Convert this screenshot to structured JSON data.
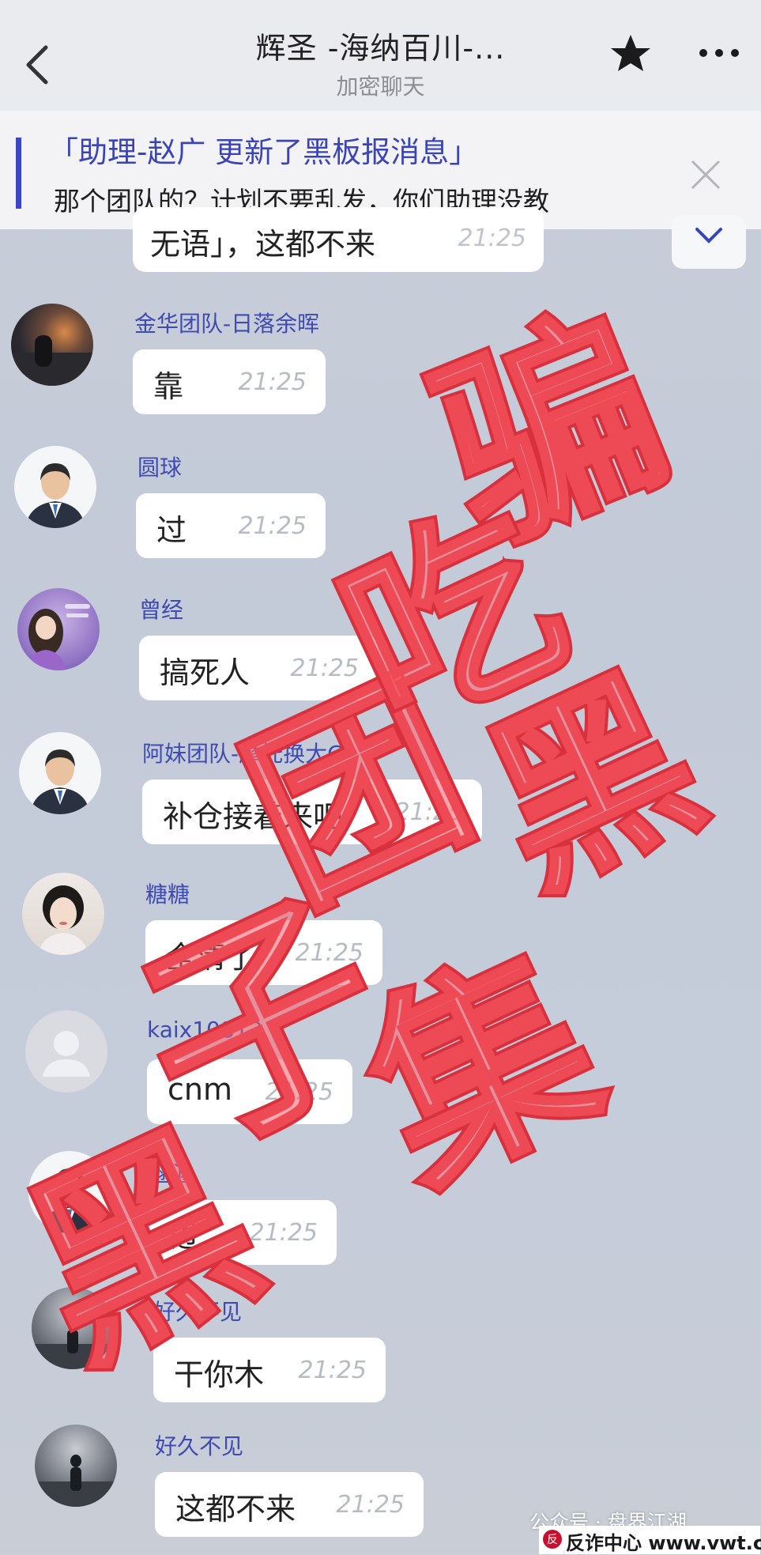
{
  "header": {
    "title": "辉圣 -海纳百川-...",
    "subtitle": "加密聊天"
  },
  "banner": {
    "title": "「助理-赵广 更新了黑板报消息」",
    "text": "那个团队的？计划不要乱发，你们助理没教"
  },
  "previous_message": {
    "text": "无语」，这都不来",
    "time": "21:25"
  },
  "messages": [
    {
      "sender": "金华团队-日落余晖",
      "text": "靠",
      "time": "21:25",
      "avatar": "sunset-photo"
    },
    {
      "sender": "圆球",
      "text": "过",
      "time": "21:25",
      "avatar": "businessman"
    },
    {
      "sender": "曾经",
      "text": "搞死人",
      "time": "21:25",
      "avatar": "cartoon-girl"
    },
    {
      "sender": "阿妹团队-摩托换大G",
      "text": "补仓接着来吧",
      "time": "21:25",
      "avatar": "businessman"
    },
    {
      "sender": "糖糖",
      "text": "全清了",
      "time": "21:25",
      "avatar": "woman-portrait"
    },
    {
      "sender": "kaix10813",
      "text": "cnm",
      "time": "21:25",
      "avatar": "default-gray"
    },
    {
      "sender": "涵涵",
      "text": "过",
      "time": "21:25",
      "avatar": "businessman"
    },
    {
      "sender": "好久不见",
      "text": "干你木",
      "time": "21:25",
      "avatar": "dark-figure"
    },
    {
      "sender": "好久不见",
      "text": "这都不来",
      "time": "21:25",
      "avatar": "dark-figure"
    }
  ],
  "stamp": {
    "chars": [
      "骗",
      "子",
      "集",
      "团",
      "黑",
      "吃",
      "黑"
    ],
    "color": "#e0323c"
  },
  "watermark": {
    "account": "公众号 · 盘界江湖",
    "logo": "反诈中心 www.vwt.cc"
  },
  "colors": {
    "accent": "#3a44b8",
    "sender": "#3f4bb3",
    "background": "#c6ccd9"
  }
}
